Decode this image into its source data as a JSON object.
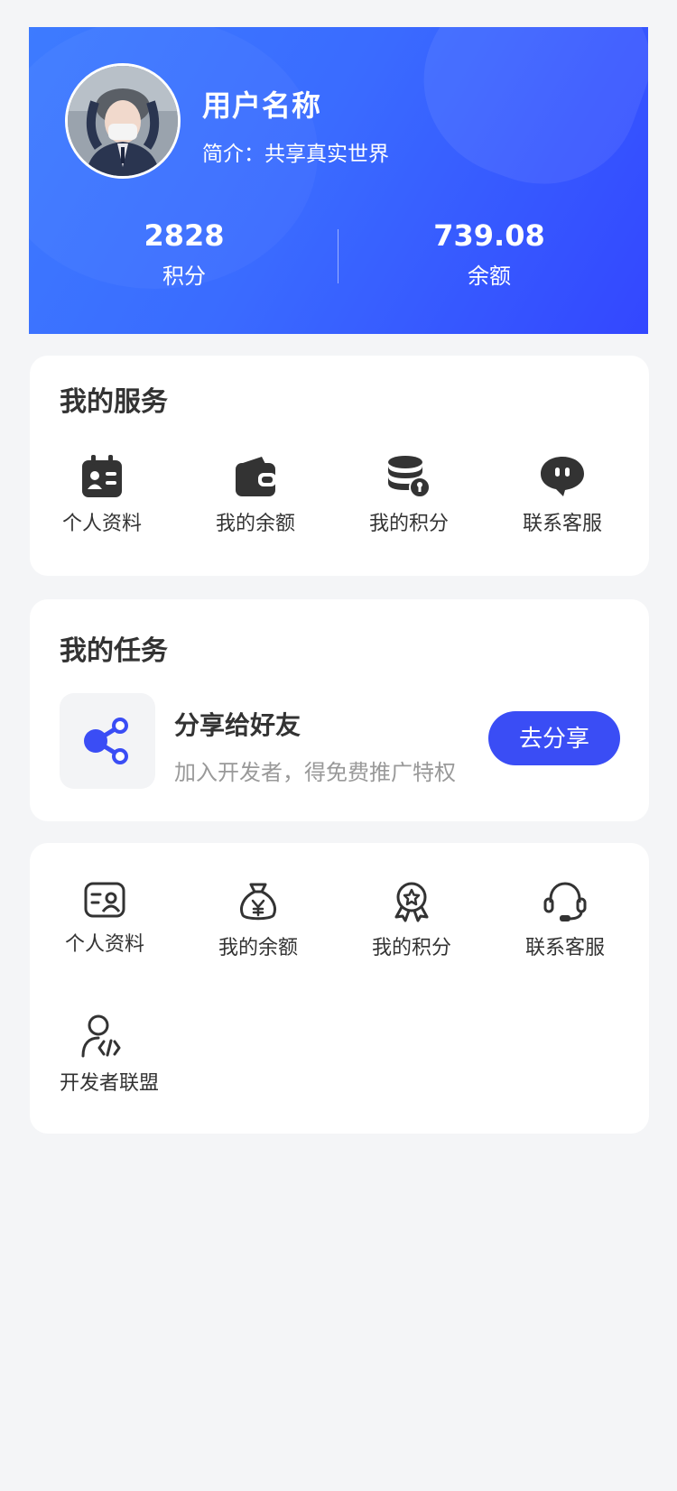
{
  "profile": {
    "username": "用户名称",
    "bio": "简介：共享真实世界",
    "points_value": "2828",
    "points_label": "积分",
    "balance_value": "739.08",
    "balance_label": "余额"
  },
  "services": {
    "title": "我的服务",
    "items": [
      {
        "label": "个人资料",
        "icon": "profile-card-icon"
      },
      {
        "label": "我的余额",
        "icon": "wallet-icon"
      },
      {
        "label": "我的积分",
        "icon": "coins-icon"
      },
      {
        "label": "联系客服",
        "icon": "chat-icon"
      }
    ]
  },
  "tasks": {
    "title": "我的任务",
    "task": {
      "title": "分享给好友",
      "desc": "加入开发者，得免费推广特权",
      "button": "去分享",
      "icon": "share-icon"
    }
  },
  "menu": {
    "items": [
      {
        "label": "个人资料",
        "icon": "id-card-icon"
      },
      {
        "label": "我的余额",
        "icon": "money-bag-icon"
      },
      {
        "label": "我的积分",
        "icon": "award-icon"
      },
      {
        "label": "联系客服",
        "icon": "headset-icon"
      },
      {
        "label": "开发者联盟",
        "icon": "developer-icon"
      }
    ]
  },
  "colors": {
    "accent": "#3a4df5",
    "header_gradient_start": "#3d7bff",
    "header_gradient_end": "#3347ff",
    "background": "#f4f5f7"
  }
}
